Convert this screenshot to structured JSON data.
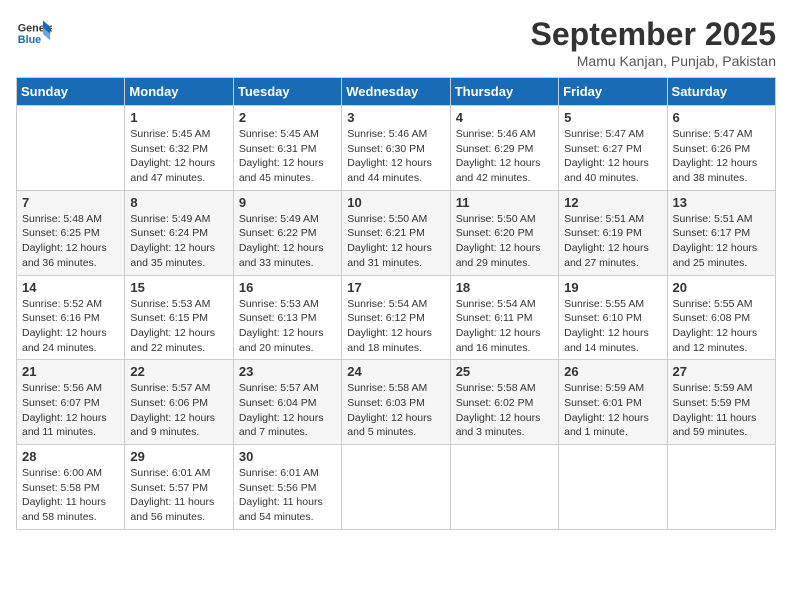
{
  "header": {
    "logo_line1": "General",
    "logo_line2": "Blue",
    "month_year": "September 2025",
    "location": "Mamu Kanjan, Punjab, Pakistan"
  },
  "weekdays": [
    "Sunday",
    "Monday",
    "Tuesday",
    "Wednesday",
    "Thursday",
    "Friday",
    "Saturday"
  ],
  "weeks": [
    [
      {
        "day": "",
        "info": ""
      },
      {
        "day": "1",
        "info": "Sunrise: 5:45 AM\nSunset: 6:32 PM\nDaylight: 12 hours\nand 47 minutes."
      },
      {
        "day": "2",
        "info": "Sunrise: 5:45 AM\nSunset: 6:31 PM\nDaylight: 12 hours\nand 45 minutes."
      },
      {
        "day": "3",
        "info": "Sunrise: 5:46 AM\nSunset: 6:30 PM\nDaylight: 12 hours\nand 44 minutes."
      },
      {
        "day": "4",
        "info": "Sunrise: 5:46 AM\nSunset: 6:29 PM\nDaylight: 12 hours\nand 42 minutes."
      },
      {
        "day": "5",
        "info": "Sunrise: 5:47 AM\nSunset: 6:27 PM\nDaylight: 12 hours\nand 40 minutes."
      },
      {
        "day": "6",
        "info": "Sunrise: 5:47 AM\nSunset: 6:26 PM\nDaylight: 12 hours\nand 38 minutes."
      }
    ],
    [
      {
        "day": "7",
        "info": "Sunrise: 5:48 AM\nSunset: 6:25 PM\nDaylight: 12 hours\nand 36 minutes."
      },
      {
        "day": "8",
        "info": "Sunrise: 5:49 AM\nSunset: 6:24 PM\nDaylight: 12 hours\nand 35 minutes."
      },
      {
        "day": "9",
        "info": "Sunrise: 5:49 AM\nSunset: 6:22 PM\nDaylight: 12 hours\nand 33 minutes."
      },
      {
        "day": "10",
        "info": "Sunrise: 5:50 AM\nSunset: 6:21 PM\nDaylight: 12 hours\nand 31 minutes."
      },
      {
        "day": "11",
        "info": "Sunrise: 5:50 AM\nSunset: 6:20 PM\nDaylight: 12 hours\nand 29 minutes."
      },
      {
        "day": "12",
        "info": "Sunrise: 5:51 AM\nSunset: 6:19 PM\nDaylight: 12 hours\nand 27 minutes."
      },
      {
        "day": "13",
        "info": "Sunrise: 5:51 AM\nSunset: 6:17 PM\nDaylight: 12 hours\nand 25 minutes."
      }
    ],
    [
      {
        "day": "14",
        "info": "Sunrise: 5:52 AM\nSunset: 6:16 PM\nDaylight: 12 hours\nand 24 minutes."
      },
      {
        "day": "15",
        "info": "Sunrise: 5:53 AM\nSunset: 6:15 PM\nDaylight: 12 hours\nand 22 minutes."
      },
      {
        "day": "16",
        "info": "Sunrise: 5:53 AM\nSunset: 6:13 PM\nDaylight: 12 hours\nand 20 minutes."
      },
      {
        "day": "17",
        "info": "Sunrise: 5:54 AM\nSunset: 6:12 PM\nDaylight: 12 hours\nand 18 minutes."
      },
      {
        "day": "18",
        "info": "Sunrise: 5:54 AM\nSunset: 6:11 PM\nDaylight: 12 hours\nand 16 minutes."
      },
      {
        "day": "19",
        "info": "Sunrise: 5:55 AM\nSunset: 6:10 PM\nDaylight: 12 hours\nand 14 minutes."
      },
      {
        "day": "20",
        "info": "Sunrise: 5:55 AM\nSunset: 6:08 PM\nDaylight: 12 hours\nand 12 minutes."
      }
    ],
    [
      {
        "day": "21",
        "info": "Sunrise: 5:56 AM\nSunset: 6:07 PM\nDaylight: 12 hours\nand 11 minutes."
      },
      {
        "day": "22",
        "info": "Sunrise: 5:57 AM\nSunset: 6:06 PM\nDaylight: 12 hours\nand 9 minutes."
      },
      {
        "day": "23",
        "info": "Sunrise: 5:57 AM\nSunset: 6:04 PM\nDaylight: 12 hours\nand 7 minutes."
      },
      {
        "day": "24",
        "info": "Sunrise: 5:58 AM\nSunset: 6:03 PM\nDaylight: 12 hours\nand 5 minutes."
      },
      {
        "day": "25",
        "info": "Sunrise: 5:58 AM\nSunset: 6:02 PM\nDaylight: 12 hours\nand 3 minutes."
      },
      {
        "day": "26",
        "info": "Sunrise: 5:59 AM\nSunset: 6:01 PM\nDaylight: 12 hours\nand 1 minute."
      },
      {
        "day": "27",
        "info": "Sunrise: 5:59 AM\nSunset: 5:59 PM\nDaylight: 11 hours\nand 59 minutes."
      }
    ],
    [
      {
        "day": "28",
        "info": "Sunrise: 6:00 AM\nSunset: 5:58 PM\nDaylight: 11 hours\nand 58 minutes."
      },
      {
        "day": "29",
        "info": "Sunrise: 6:01 AM\nSunset: 5:57 PM\nDaylight: 11 hours\nand 56 minutes."
      },
      {
        "day": "30",
        "info": "Sunrise: 6:01 AM\nSunset: 5:56 PM\nDaylight: 11 hours\nand 54 minutes."
      },
      {
        "day": "",
        "info": ""
      },
      {
        "day": "",
        "info": ""
      },
      {
        "day": "",
        "info": ""
      },
      {
        "day": "",
        "info": ""
      }
    ]
  ]
}
